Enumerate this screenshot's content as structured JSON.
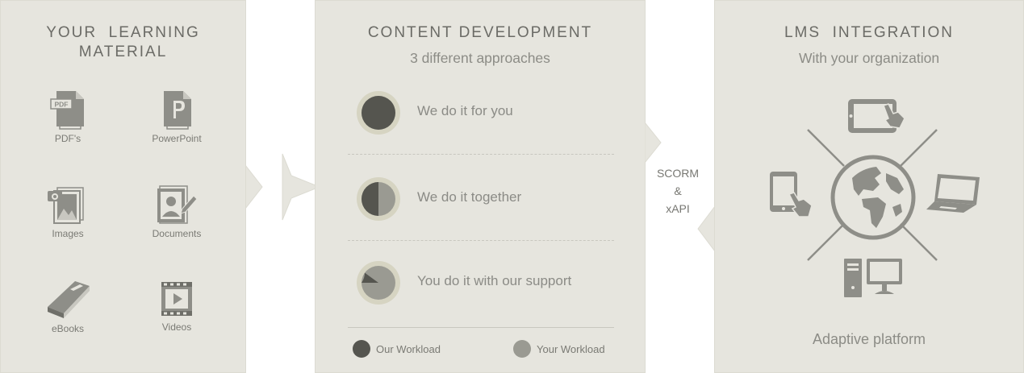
{
  "learning_material": {
    "title": "YOUR  LEARNING\nMATERIAL",
    "items": [
      {
        "label": "PDF's",
        "icon": "pdf-icon"
      },
      {
        "label": "PowerPoint",
        "icon": "powerpoint-icon"
      },
      {
        "label": "Images",
        "icon": "images-icon"
      },
      {
        "label": "Documents",
        "icon": "documents-icon"
      },
      {
        "label": "eBooks",
        "icon": "ebook-icon"
      },
      {
        "label": "Videos",
        "icon": "video-icon"
      }
    ]
  },
  "content_development": {
    "title": "CONTENT DEVELOPMENT",
    "subtitle": "3 different approaches",
    "approaches": [
      {
        "label": "We do it for you",
        "our_workload": 1.0
      },
      {
        "label": "We do it together",
        "our_workload": 0.5
      },
      {
        "label": "You do it with our support",
        "our_workload": 0.1
      }
    ],
    "legend": [
      {
        "label": "Our Workload",
        "color": "#55554f"
      },
      {
        "label": "Your Workload",
        "color": "#9a9a92"
      }
    ]
  },
  "standards": {
    "line1": "SCORM",
    "line2": "&",
    "line3": "xAPI"
  },
  "lms": {
    "title": "LMS  INTEGRATION",
    "subtitle": "With your organization",
    "platform_label": "Adaptive platform",
    "devices": [
      "tablet-touch-icon",
      "phone-touch-icon",
      "laptop-icon",
      "desktop-computer-icon",
      "globe-icon"
    ]
  },
  "colors": {
    "panel": "#e6e5de",
    "icon": "#8e8e88",
    "dark": "#55554f",
    "light": "#9a9a92",
    "ring": "#d6d4c2"
  }
}
